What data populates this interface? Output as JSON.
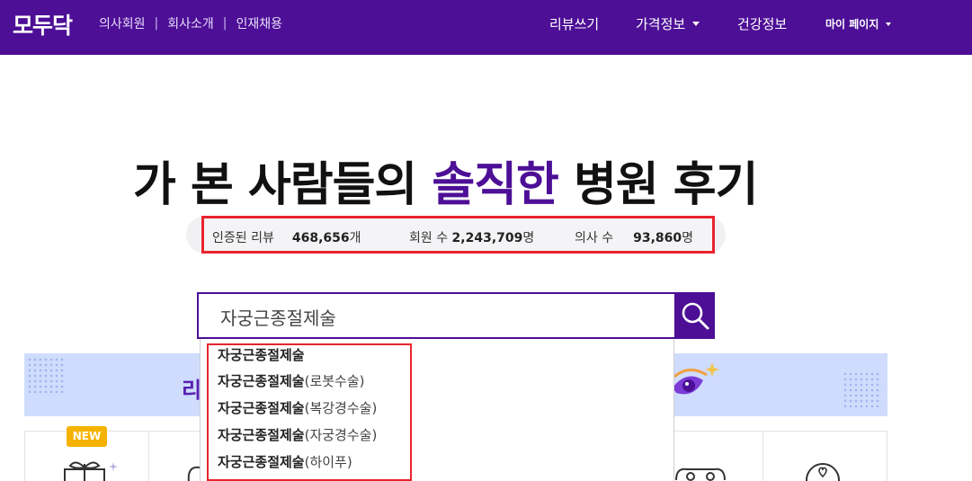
{
  "header": {
    "logo": "모두닥",
    "sublinks": [
      "의사회원",
      "회사소개",
      "인재채용"
    ],
    "separator": "|",
    "nav": {
      "review": "리뷰쓰기",
      "price": "가격정보",
      "health": "건강정보",
      "mypage": "마이 페이지"
    }
  },
  "hero": {
    "title_before": "가 본 사람들의 ",
    "title_accent": "솔직한",
    "title_after": " 병원 후기"
  },
  "stats": {
    "reviews_label": "인증된 리뷰",
    "reviews_value": "468,656",
    "reviews_unit": "개",
    "members_label": "회원 수",
    "members_value": "2,243,709",
    "members_unit": "명",
    "doctors_label": "의사 수",
    "doctors_value": "93,860",
    "doctors_unit": "명"
  },
  "search": {
    "value": "자궁근종절제술"
  },
  "suggestions": [
    {
      "main": "자궁근종절제술",
      "sub": ""
    },
    {
      "main": "자궁근종절제술",
      "sub": "(로봇수술)"
    },
    {
      "main": "자궁근종절제술",
      "sub": "(복강경수술)"
    },
    {
      "main": "자궁근종절제술",
      "sub": "(자궁경수술)"
    },
    {
      "main": "자궁근종절제술",
      "sub": "(하이푸)"
    }
  ],
  "banner": {
    "text_partial": "리"
  },
  "cards": {
    "new_badge": "NEW"
  },
  "colors": {
    "brand": "#4d0f96",
    "highlight": "#e8242f",
    "banner": "#cfdcfd",
    "badge": "#f5b300"
  }
}
